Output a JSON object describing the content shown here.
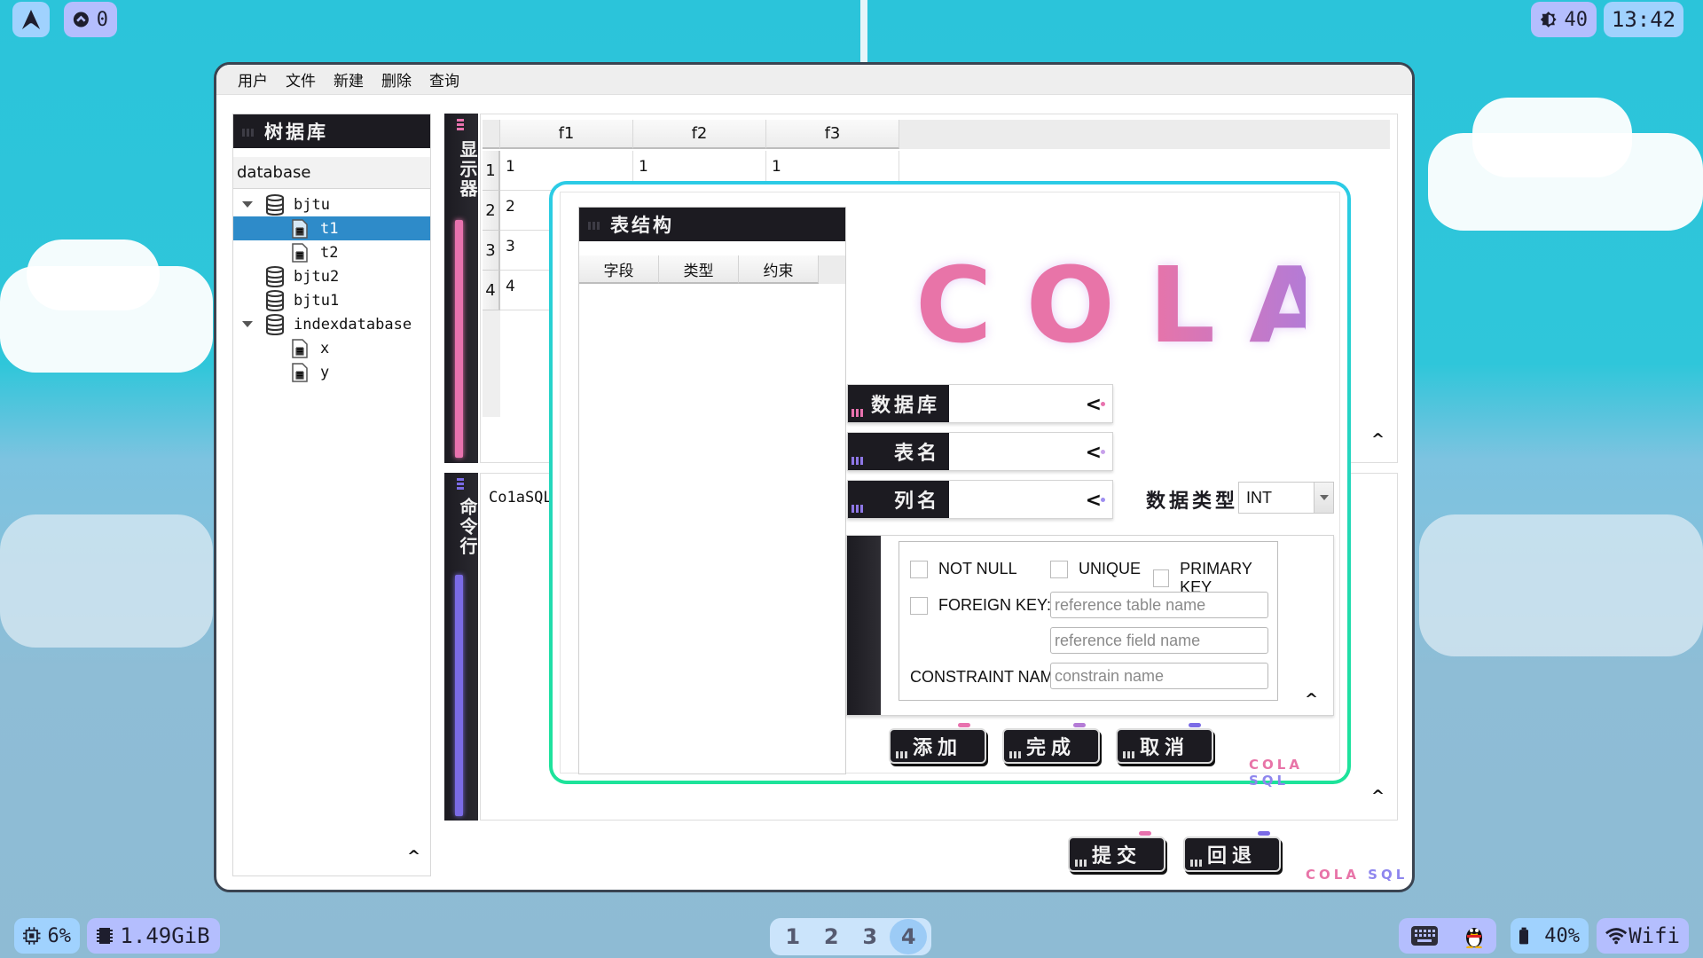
{
  "topbar": {
    "launcher_icon": "arch-logo-icon",
    "updates": {
      "icon": "updates-arrow-icon",
      "count": "0"
    },
    "brightness": {
      "icon": "brightness-icon",
      "value": "40"
    },
    "clock": "13:42"
  },
  "bottombar": {
    "cpu": {
      "icon": "cpu-icon",
      "value": "6%"
    },
    "memory": {
      "icon": "memory-icon",
      "value": "1.49GiB"
    },
    "workspaces": [
      "1",
      "2",
      "3",
      "4"
    ],
    "active_workspace": "4",
    "tray": {
      "keyboard_icon": "keyboard-icon",
      "qq_icon": "qq-penguin-icon"
    },
    "battery": {
      "icon": "battery-icon",
      "value": "40%"
    },
    "network": {
      "icon": "wifi-icon",
      "label": "Wifi"
    }
  },
  "window": {
    "menu": [
      "用户",
      "文件",
      "新建",
      "删除",
      "查询"
    ],
    "tree_panel": {
      "title": "树据库",
      "header": "database",
      "items": [
        {
          "label": "bjtu",
          "type": "database",
          "expanded": true,
          "level": 0
        },
        {
          "label": "t1",
          "type": "table",
          "level": 1,
          "selected": true
        },
        {
          "label": "t2",
          "type": "table",
          "level": 1
        },
        {
          "label": "bjtu2",
          "type": "database",
          "level": 0
        },
        {
          "label": "bjtu1",
          "type": "database",
          "level": 0
        },
        {
          "label": "indexdatabase",
          "type": "database",
          "expanded": true,
          "level": 0
        },
        {
          "label": "x",
          "type": "table",
          "level": 1
        },
        {
          "label": "y",
          "type": "table",
          "level": 1
        }
      ]
    },
    "display_panel": {
      "rail_label": "显示器",
      "accent": "#e872ae",
      "table": {
        "columns": [
          "f1",
          "f2",
          "f3"
        ],
        "row_headers": [
          "1",
          "2",
          "3",
          "4"
        ],
        "rows": [
          [
            "1",
            "1",
            "1"
          ],
          [
            "2",
            "",
            ""
          ],
          [
            "3",
            "",
            ""
          ],
          [
            "4",
            "",
            ""
          ]
        ]
      }
    },
    "command_panel": {
      "rail_label": "命令行",
      "accent": "#7b6be6",
      "text": "Co1aSQL"
    },
    "buttons": {
      "submit": "提交",
      "rollback": "回退"
    },
    "brand": {
      "left": "COLA",
      "right": "SQL"
    }
  },
  "dialog": {
    "structure_panel": {
      "title": "表结构",
      "columns": [
        "字段",
        "类型",
        "约束"
      ]
    },
    "logo": "COLA",
    "fields": {
      "database": {
        "label": "数据库",
        "value": ""
      },
      "table": {
        "label": "表名",
        "value": ""
      },
      "column": {
        "label": "列名",
        "value": ""
      }
    },
    "data_type": {
      "label": "数据类型",
      "value": "INT"
    },
    "constraints": {
      "not_null": {
        "label": "NOT NULL",
        "checked": false
      },
      "unique": {
        "label": "UNIQUE",
        "checked": false
      },
      "primary_key": {
        "label": "PRIMARY KEY",
        "checked": false
      },
      "foreign_key": {
        "label": "FOREIGN KEY:",
        "checked": false
      },
      "ref_table_placeholder": "reference table name",
      "ref_field_placeholder": "reference field name",
      "constraint_name_label": "CONSTRAINT NAM",
      "constraint_name_placeholder": "constrain name"
    },
    "buttons": {
      "add": "添加",
      "done": "完成",
      "cancel": "取消"
    },
    "brand": {
      "left": "COLA",
      "right": "SQL"
    },
    "colors": {
      "pink": "#e872ae",
      "purple": "#b47bd6",
      "violet": "#7b6be6",
      "border_top": "#2ccbe6",
      "border_bottom": "#1de39a"
    }
  }
}
